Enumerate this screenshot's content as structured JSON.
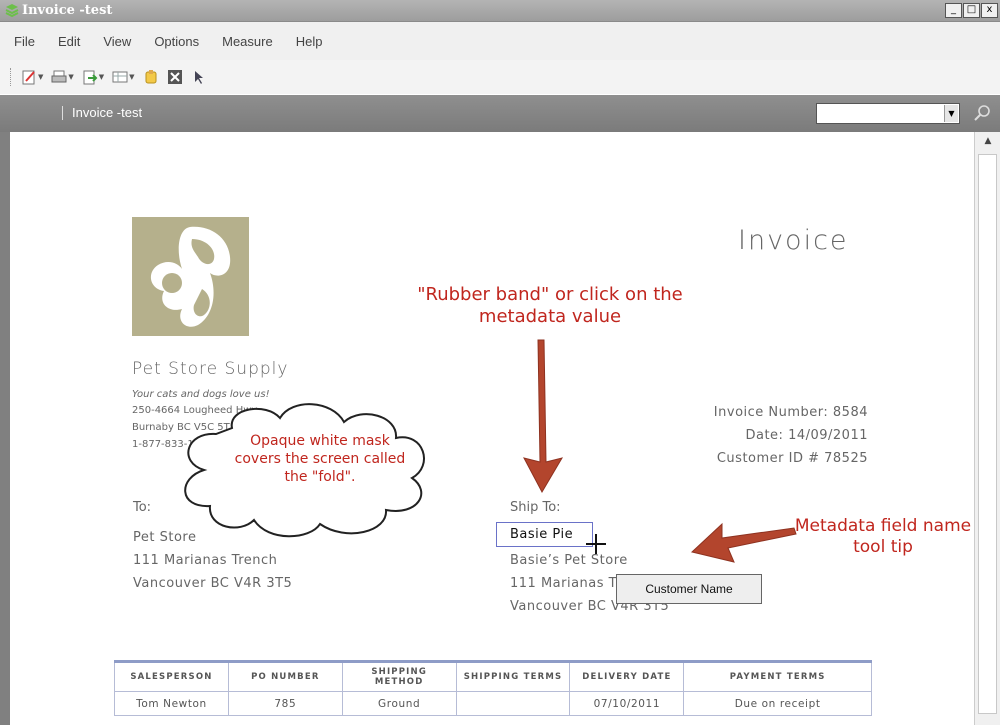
{
  "window": {
    "title": "Invoice -test",
    "buttons": [
      "_",
      "□",
      "x"
    ]
  },
  "menu": [
    "File",
    "Edit",
    "View",
    "Options",
    "Measure",
    "Help"
  ],
  "toolbar": {
    "icons": [
      "edit-icon",
      "print-icon",
      "export-icon",
      "layout-icon",
      "highlight-icon",
      "close-doc-icon",
      "pointer-icon"
    ]
  },
  "address": {
    "doc_name": "Invoice -test",
    "combo_value": ""
  },
  "document": {
    "company": "Pet Store Supply",
    "tagline": "Your cats and dogs love us!",
    "address_lines": [
      "250-4664 Lougheed Hwy",
      "Burnaby BC V5C 5T5",
      "1-877-833-1202"
    ],
    "title": "Invoice",
    "invoice_number": "Invoice Number: 8584",
    "date": "Date: 14/09/2011",
    "customer_id": "Customer ID # 78525",
    "to_label": "To:",
    "to_lines": [
      "Pet Store",
      "111 Marianas Trench",
      "Vancouver BC V4R 3T5"
    ],
    "ship_label": "Ship To:",
    "ship_selected": "Basie Pie",
    "ship_lines": [
      "Basie’s Pet Store",
      "111 Marianas Trench",
      "Vancouver BC V4R 3T5"
    ],
    "table": {
      "headers": [
        "SALESPERSON",
        "PO NUMBER",
        "SHIPPING METHOD",
        "SHIPPING TERMS",
        "DELIVERY DATE",
        "PAYMENT TERMS"
      ],
      "rows": [
        [
          "Tom Newton",
          "785",
          "Ground",
          "",
          "07/10/2011",
          "Due on receipt"
        ]
      ]
    }
  },
  "tooltip": "Customer Name",
  "annotations": {
    "rubber_band": "\"Rubber band\"  or click on the metadata value",
    "metadata_tip": "Metadata field name tool tip",
    "cloud": "Opaque white mask covers the screen called the \"fold\"."
  },
  "colors": {
    "annotation": "#c0261e",
    "arrow": "#b3452d",
    "logo": "#b5b08c",
    "table_border": "#8e9cc7"
  }
}
